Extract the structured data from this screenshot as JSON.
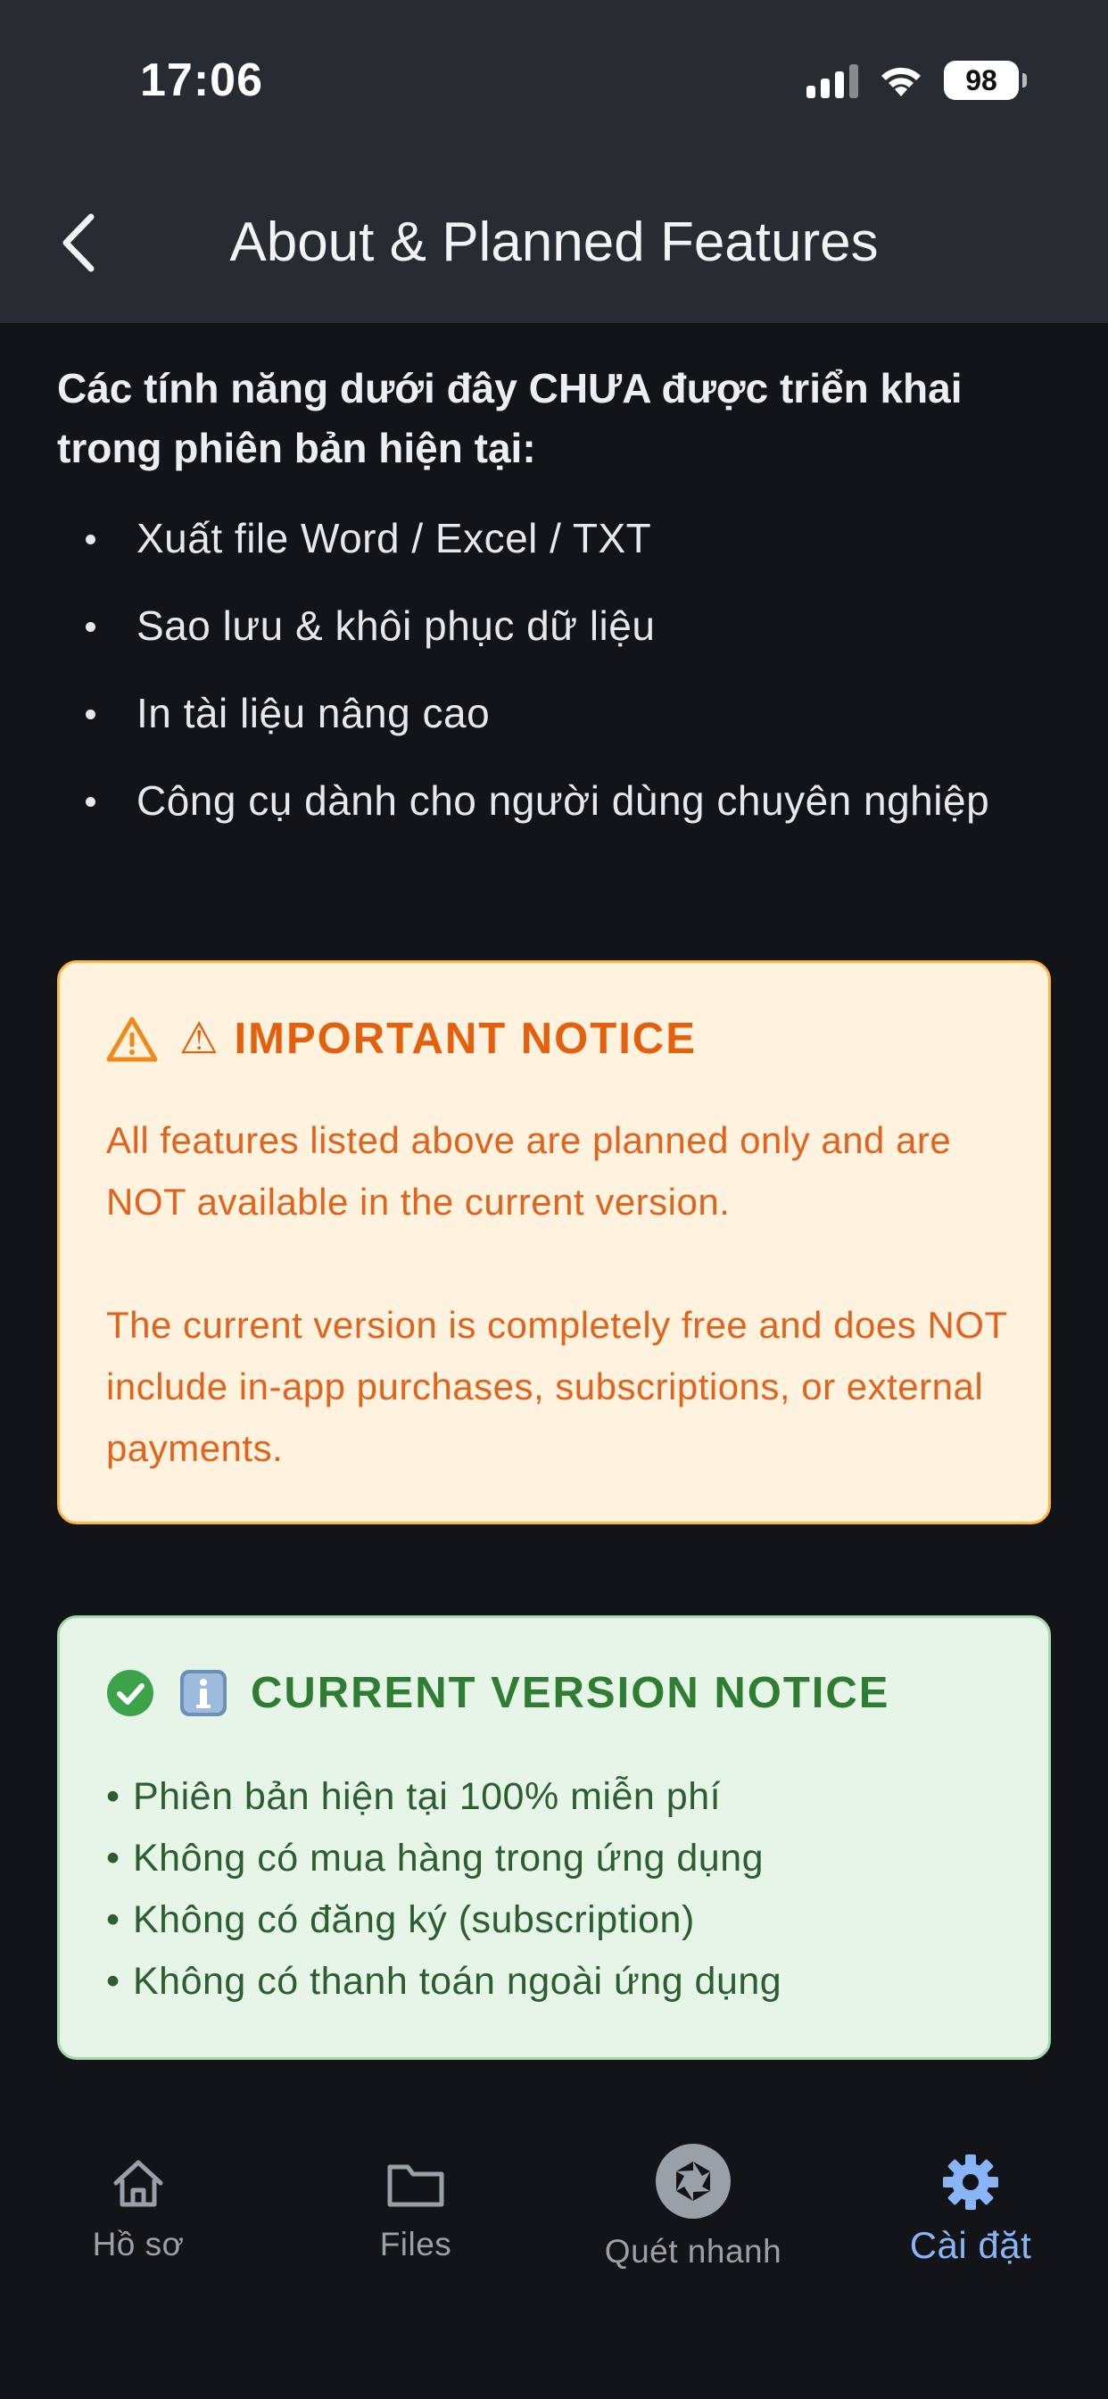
{
  "status_bar": {
    "time": "17:06",
    "battery": "98"
  },
  "header": {
    "title": "About & Planned Features"
  },
  "intro": {
    "heading": "Các tính năng dưới đây CHƯA được triển khai trong phiên bản hiện tại:",
    "items": [
      "Xuất file Word / Excel / TXT",
      "Sao lưu & khôi phục dữ liệu",
      "In tài liệu nâng cao",
      "Công cụ dành cho người dùng chuyên nghiệp"
    ]
  },
  "important_notice": {
    "title": "⚠ IMPORTANT NOTICE",
    "paragraph1": "All features listed above are planned only and are NOT available in the current version.",
    "paragraph2": "The current version is completely free and does NOT include in-app purchases, subscriptions, or external payments."
  },
  "current_version_notice": {
    "title": "CURRENT VERSION NOTICE",
    "items": [
      "Phiên bản hiện tại 100% miễn phí",
      "Không có mua hàng trong ứng dụng",
      "Không có đăng ký (subscription)",
      "Không có thanh toán ngoài ứng dụng"
    ]
  },
  "tabbar": {
    "tabs": [
      {
        "label": "Hồ sơ",
        "icon": "home-icon"
      },
      {
        "label": "Files",
        "icon": "folder-icon"
      },
      {
        "label": "Quét nhanh",
        "icon": "camera-shutter-icon"
      },
      {
        "label": "Cài đặt",
        "icon": "gear-icon",
        "active": true
      }
    ]
  },
  "colors": {
    "background": "#121418",
    "header": "#272b32",
    "warning_bg": "#fff3e0",
    "warning_text": "#e4600d",
    "info_bg": "#e7f5e8",
    "info_text": "#2e7d32",
    "active_tab": "#8ab4f8"
  }
}
